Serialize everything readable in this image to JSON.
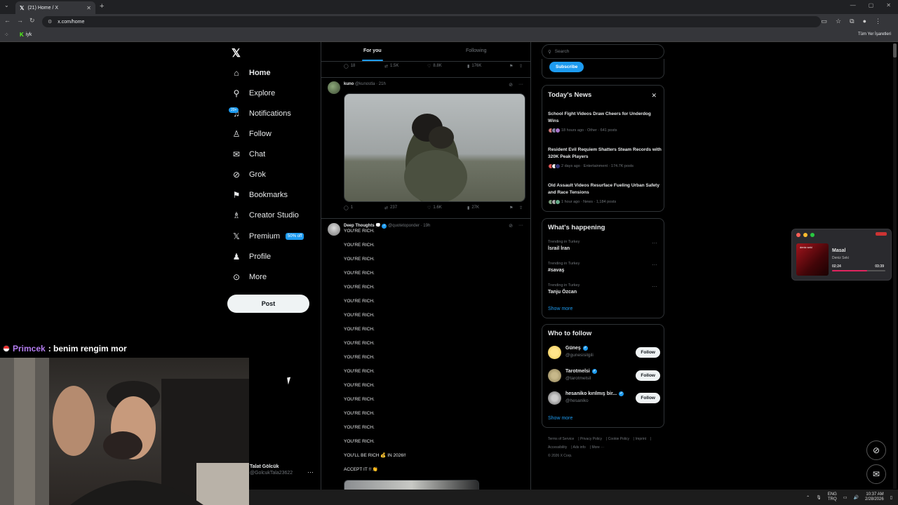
{
  "browser": {
    "tab_title": "(21) Home / X",
    "url": "x.com/home",
    "bookmark_label": "iyk",
    "all_bookmarks": "Tüm Yer İşaretleri"
  },
  "nav": {
    "items": [
      {
        "label": "Home",
        "icon": "home-icon"
      },
      {
        "label": "Explore",
        "icon": "search-icon"
      },
      {
        "label": "Notifications",
        "icon": "bell-icon"
      },
      {
        "label": "Follow",
        "icon": "person-add-icon"
      },
      {
        "label": "Chat",
        "icon": "mail-icon"
      },
      {
        "label": "Grok",
        "icon": "grok-icon"
      },
      {
        "label": "Bookmarks",
        "icon": "bookmark-icon"
      },
      {
        "label": "Creator Studio",
        "icon": "creator-icon"
      },
      {
        "label": "Premium",
        "icon": "x-icon"
      },
      {
        "label": "Profile",
        "icon": "person-icon"
      },
      {
        "label": "More",
        "icon": "more-icon"
      }
    ],
    "notif_badge": "20+",
    "premium_badge": "50% off",
    "post_label": "Post",
    "user_name": "Talat Gölcük",
    "user_handle": "@GolcukTala23622"
  },
  "feed": {
    "tab_for_you": "For you",
    "tab_following": "Following",
    "top_actions": {
      "replies": "18",
      "reposts": "1.5K",
      "likes": "8.8K",
      "views": "176K"
    },
    "tweet1": {
      "name": "kuno",
      "handle": "@kunostla · 21h",
      "actions": {
        "replies": "1",
        "reposts": "237",
        "likes": "1.6K",
        "views": "27K"
      }
    },
    "tweet2": {
      "name": "Deep Thoughts 💭",
      "handle": "@quotetoponder · 19h",
      "lines": [
        "YOU'RE RICH.",
        "YOU'RE RICH.",
        "YOU'RE RICH.",
        "YOU'RE RICH.",
        "YOU'RE RICH.",
        "YOU'RE RICH.",
        "YOU'RE RICH.",
        "YOU'RE RICH.",
        "YOU'RE RICH.",
        "YOU'RE RICH.",
        "YOU'RE RICH.",
        "YOU'RE RICH.",
        "YOU'RE RICH.",
        "YOU'RE RICH.",
        "YOU'RE RICH.",
        "YOU'RE RICH.",
        "YOU'LL BE RICH 💰 IN 2026!!",
        "ACCEPT IT !! 👏"
      ]
    }
  },
  "right": {
    "search_placeholder": "Search",
    "subscribe": "Subscribe",
    "news_title": "Today's News",
    "news": [
      {
        "headline": "School Fight Videos Draw Cheers for Underdog Wins",
        "meta": "18 hours ago · Other · 641 posts"
      },
      {
        "headline": "Resident Evil Requiem Shatters Steam Records with 320K Peak Players",
        "meta": "2 days ago · Entertainment · 174.7K posts"
      },
      {
        "headline": "Old Assault Videos Resurface Fueling Urban Safety and Race Tensions",
        "meta": "1 hour ago · News · 1,184 posts"
      }
    ],
    "happening_title": "What's happening",
    "trends": [
      {
        "context": "Trending in Turkey",
        "topic": "İsrail İran"
      },
      {
        "context": "Trending in Turkey",
        "topic": "#savaş"
      },
      {
        "context": "Trending in Turkey",
        "topic": "Tanju Özcan"
      }
    ],
    "show_more": "Show more",
    "who_title": "Who to follow",
    "who": [
      {
        "name": "Güneş",
        "handle": "@gunesisilgili"
      },
      {
        "name": "Tarotmelsi",
        "handle": "@tarotmelsil"
      },
      {
        "name": "hesaniko kırılmış bir...",
        "handle": "@hesaniko"
      }
    ],
    "follow_label": "Follow",
    "footer": [
      "Terms of Service",
      "Privacy Policy",
      "Cookie Policy",
      "Imprint",
      "Accessibility",
      "Ads info",
      "More ···",
      "© 2026 X Corp."
    ]
  },
  "music": {
    "title": "Masal",
    "artist": "Deniz Seki",
    "current": "02:24",
    "total": "03:39",
    "cover_text": "deniz seki",
    "progress": 0.66
  },
  "stream": {
    "chat_user": "Primcek",
    "chat_text": ": benim rengim mor"
  },
  "taskbar": {
    "lang1": "ENG",
    "lang2": "TRQ",
    "time": "10:37 AM",
    "date": "2/28/2026"
  }
}
